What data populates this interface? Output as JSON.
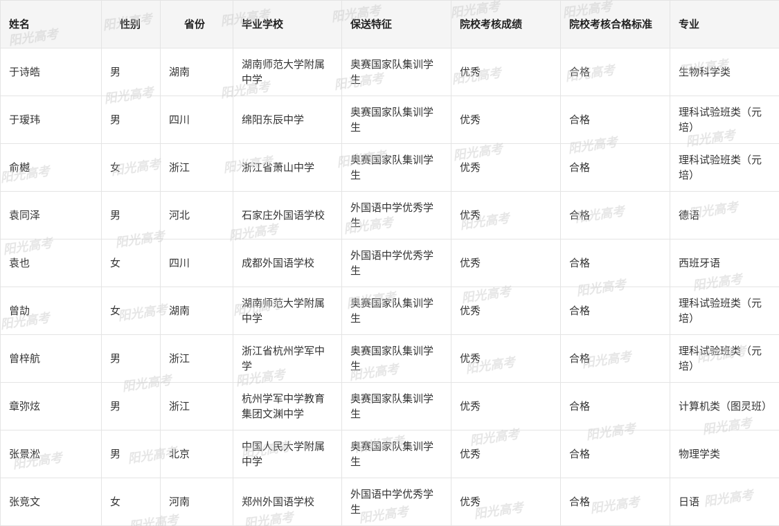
{
  "table": {
    "headers": [
      "姓名",
      "性别",
      "省份",
      "毕业学校",
      "保送特征",
      "院校考核成绩",
      "院校考核合格标准",
      "专业"
    ],
    "rows": [
      [
        "于诗皓",
        "男",
        "湖南",
        "湖南师范大学附属中学",
        "奥赛国家队集训学生",
        "优秀",
        "合格",
        "生物科学类"
      ],
      [
        "于瑷玮",
        "男",
        "四川",
        "绵阳东辰中学",
        "奥赛国家队集训学生",
        "优秀",
        "合格",
        "理科试验班类（元培）"
      ],
      [
        "俞樾",
        "女",
        "浙江",
        "浙江省萧山中学",
        "奥赛国家队集训学生",
        "优秀",
        "合格",
        "理科试验班类（元培）"
      ],
      [
        "袁同泽",
        "男",
        "河北",
        "石家庄外国语学校",
        "外国语中学优秀学生",
        "优秀",
        "合格",
        "德语"
      ],
      [
        "袁也",
        "女",
        "四川",
        "成都外国语学校",
        "外国语中学优秀学生",
        "优秀",
        "合格",
        "西班牙语"
      ],
      [
        "曾劼",
        "女",
        "湖南",
        "湖南师范大学附属中学",
        "奥赛国家队集训学生",
        "优秀",
        "合格",
        "理科试验班类（元培）"
      ],
      [
        "曾梓航",
        "男",
        "浙江",
        "浙江省杭州学军中学",
        "奥赛国家队集训学生",
        "优秀",
        "合格",
        "理科试验班类（元培）"
      ],
      [
        "章弥炫",
        "男",
        "浙江",
        "杭州学军中学教育集团文渊中学",
        "奥赛国家队集训学生",
        "优秀",
        "合格",
        "计算机类（图灵班）"
      ],
      [
        "张景淞",
        "男",
        "北京",
        "中国人民大学附属中学",
        "奥赛国家队集训学生",
        "优秀",
        "合格",
        "物理学类"
      ],
      [
        "张竞文",
        "女",
        "河南",
        "郑州外国语学校",
        "外国语中学优秀学生",
        "优秀",
        "合格",
        "日语"
      ]
    ]
  },
  "watermark": {
    "text": "阳光高考"
  }
}
